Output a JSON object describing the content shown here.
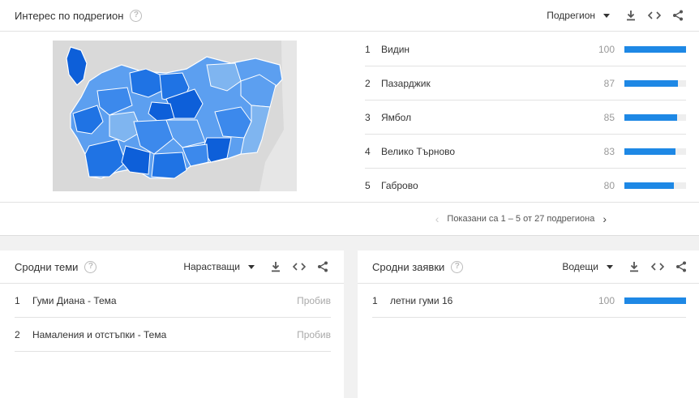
{
  "region_card": {
    "title": "Интерес по подрегион",
    "help_icon": "question-circle-icon",
    "dropdown_value": "Подрегион",
    "map_colors": {
      "lightest": "#7fb5f0",
      "light": "#5c9ff0",
      "medium": "#3c89ec",
      "dark": "#1f73e4",
      "darkest": "#0d5fd9",
      "neighbors": "#d9d9d9"
    },
    "rows": [
      {
        "rank": "1",
        "name": "Видин",
        "value": "100",
        "fill": 100
      },
      {
        "rank": "2",
        "name": "Пазарджик",
        "value": "87",
        "fill": 87
      },
      {
        "rank": "3",
        "name": "Ямбол",
        "value": "85",
        "fill": 85
      },
      {
        "rank": "4",
        "name": "Велико Търново",
        "value": "83",
        "fill": 83
      },
      {
        "rank": "5",
        "name": "Габрово",
        "value": "80",
        "fill": 80
      }
    ],
    "pager_text": "Показани са 1 – 5 от 27 подрегиона"
  },
  "topics_card": {
    "title": "Сродни теми",
    "dropdown_value": "Нарастващи",
    "rows": [
      {
        "rank": "1",
        "text": "Гуми Диана - Тема",
        "right": "Пробив"
      },
      {
        "rank": "2",
        "text": "Намаления и отстъпки - Тема",
        "right": "Пробив"
      }
    ]
  },
  "queries_card": {
    "title": "Сродни заявки",
    "dropdown_value": "Водещи",
    "rows": [
      {
        "rank": "1",
        "text": "летни гуми 16",
        "value": "100",
        "fill": 100
      }
    ]
  },
  "accent_color": "#1e88e5",
  "icons": [
    "download-icon",
    "embed-code-icon",
    "share-icon",
    "chevron-down-icon"
  ]
}
